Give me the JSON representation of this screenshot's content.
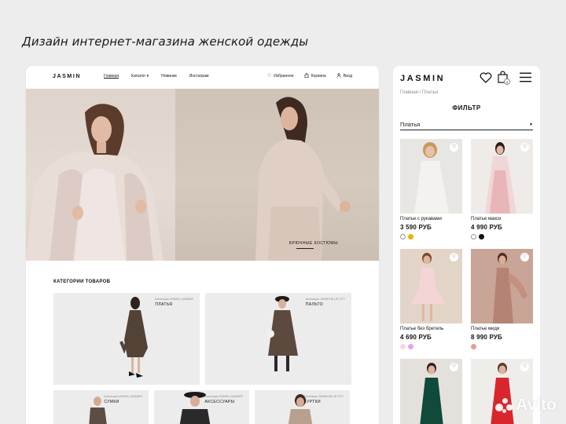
{
  "page_title": "Дизайн интернет-магазина женской одежды",
  "desktop": {
    "logo": "JASMIN",
    "menu": [
      "Главная",
      "Каталог",
      "Новинки",
      "Инстаграм"
    ],
    "actions": [
      {
        "label": "Избранное",
        "icon": "heart-icon"
      },
      {
        "label": "Корзина",
        "icon": "bag-icon"
      },
      {
        "label": "Вход",
        "icon": "user-icon"
      }
    ],
    "hero_caption": "БРЮЧНЫЕ КОСТЮМЫ",
    "categories_title": "КАТЕГОРИИ ТОВАРОВ",
    "categories": [
      {
        "collection": "Коллекция JASMIN_SUMMER",
        "name": "ПЛАТЬЯ"
      },
      {
        "collection": "Коллекция JASMIN BLUE CITY",
        "name": "ПАЛЬТО"
      },
      {
        "collection": "Коллекция JASMIN_SUMMER",
        "name": "СУМКИ"
      },
      {
        "collection": "Коллекция JASMIN_SUMMER",
        "name": "АКСЕССУАРЫ"
      },
      {
        "collection": "Коллекция JASMIN BLUE CITY",
        "name": "КУРТКИ"
      }
    ]
  },
  "mobile": {
    "logo": "JASMIN",
    "cart_count": "1",
    "breadcrumb": "Главная / Платья",
    "filter_title": "ФИЛЬТР",
    "select_value": "Платья",
    "products": [
      {
        "name": "Платье с рукавами",
        "price": "3 590 РУБ",
        "swatches": [
          "#ffffff",
          "#e8b400"
        ]
      },
      {
        "name": "Платье макси",
        "price": "4 990 РУБ",
        "swatches": [
          "#ffffff",
          "#111111"
        ]
      },
      {
        "name": "Платье без бретель",
        "price": "4 690 РУБ",
        "swatches": [
          "#f6d6de",
          "#e3a4e8"
        ]
      },
      {
        "name": "Платье миди",
        "price": "8 990 РУБ",
        "swatches": [
          "#e3a092"
        ]
      },
      {
        "name": "",
        "price": "",
        "swatches": []
      },
      {
        "name": "",
        "price": "",
        "swatches": []
      }
    ]
  },
  "watermark": "Avito"
}
